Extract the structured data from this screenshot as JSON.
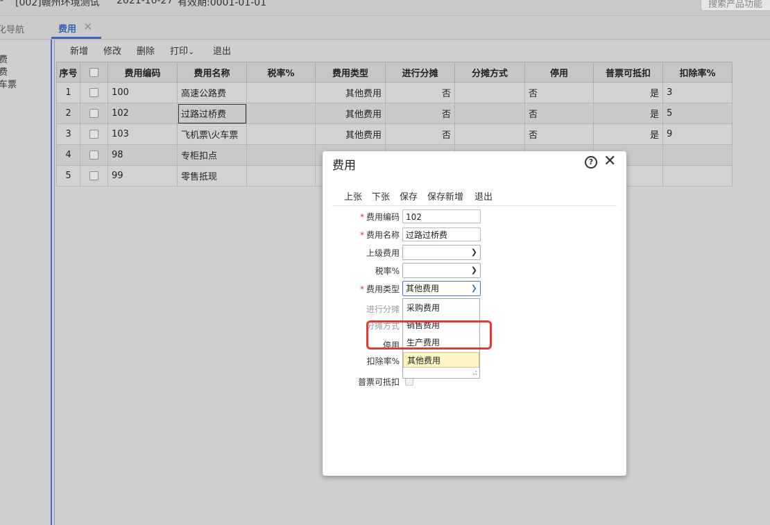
{
  "topbar": {
    "account": "[002]赣州环境测试",
    "date": "2021-10-27",
    "validity": "有效期:0001-01-01",
    "search_text": "搜索产品功能",
    "left_mark": "-"
  },
  "tabs": {
    "nav_label": "化导航",
    "active_label": "费用",
    "close_symbol": "×"
  },
  "sidebar": {
    "items": [
      "费",
      "费",
      "车票"
    ]
  },
  "toolbar": {
    "add": "新增",
    "edit": "修改",
    "delete": "删除",
    "print": "打印",
    "print_caret": "⌄",
    "exit": "退出"
  },
  "grid": {
    "headers": [
      "序号",
      "",
      "费用编码",
      "费用名称",
      "税率%",
      "费用类型",
      "进行分摊",
      "分摊方式",
      "停用",
      "普票可抵扣",
      "扣除率%"
    ],
    "rows": [
      {
        "no": "1",
        "code": "100",
        "name": "高速公路费",
        "tax": "",
        "type": "其他费用",
        "alloc": "否",
        "method": "",
        "disabled": "否",
        "deduct": "是",
        "rate": "3"
      },
      {
        "no": "2",
        "code": "102",
        "name": "过路过桥费",
        "tax": "",
        "type": "其他费用",
        "alloc": "否",
        "method": "",
        "disabled": "否",
        "deduct": "是",
        "rate": "5"
      },
      {
        "no": "3",
        "code": "103",
        "name": "飞机票\\火车票",
        "tax": "",
        "type": "其他费用",
        "alloc": "否",
        "method": "",
        "disabled": "否",
        "deduct": "是",
        "rate": "9"
      },
      {
        "no": "4",
        "code": "98",
        "name": "专柜扣点",
        "tax": "",
        "type": "",
        "alloc": "",
        "method": "",
        "disabled": "",
        "deduct": "",
        "rate": ""
      },
      {
        "no": "5",
        "code": "99",
        "name": "零售抵现",
        "tax": "",
        "type": "",
        "alloc": "",
        "method": "",
        "disabled": "",
        "deduct": "",
        "rate": ""
      }
    ]
  },
  "dialog": {
    "title": "费用",
    "help_symbol": "?",
    "close_symbol": "✕",
    "toolbar": {
      "prev": "上张",
      "next": "下张",
      "save": "保存",
      "save_new": "保存新增",
      "exit": "退出"
    },
    "required_mark": "*",
    "fields": {
      "code": {
        "label": "费用编码",
        "value": "102"
      },
      "name": {
        "label": "费用名称",
        "value": "过路过桥费"
      },
      "parent": {
        "label": "上级费用",
        "value": ""
      },
      "tax": {
        "label": "税率%",
        "value": ""
      },
      "type": {
        "label": "费用类型",
        "value": "其他费用"
      },
      "alloc": {
        "label": "进行分摊"
      },
      "method": {
        "label": "分摊方式"
      },
      "disabled": {
        "label": "停用"
      },
      "rate": {
        "label": "扣除率%"
      },
      "deduct": {
        "label": "普票可抵扣"
      }
    },
    "type_options": [
      "采购费用",
      "销售费用",
      "生产费用",
      "其他费用"
    ],
    "selected_option": "其他费用",
    "grip_symbol": ".:"
  }
}
